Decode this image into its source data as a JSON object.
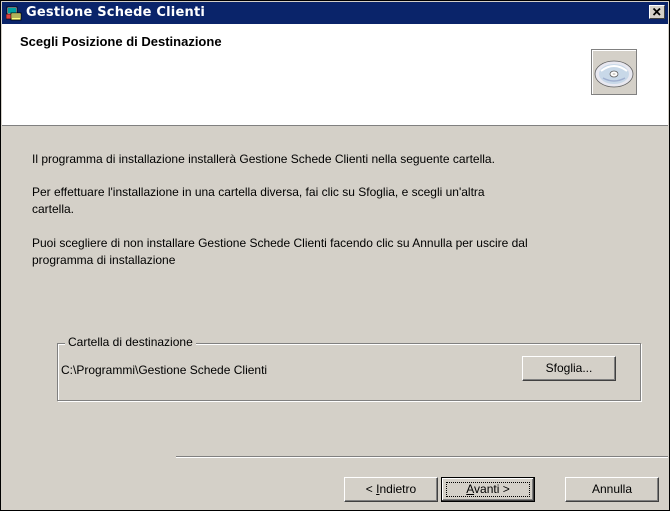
{
  "window": {
    "title": "Gestione Schede Clienti",
    "title_icon": "installer-icon",
    "close_icon": "close-icon"
  },
  "header": {
    "title": "Scegli Posizione di Destinazione",
    "icon": "cd-disc-icon"
  },
  "body": {
    "paragraph1": "Il programma di installazione installerà Gestione Schede Clienti nella seguente cartella.",
    "paragraph2_line1": "Per effettuare l'installazione in una cartella diversa, fai clic su Sfoglia, e scegli un'altra",
    "paragraph2_line2": "cartella.",
    "paragraph3_line1": "Puoi scegliere di non installare Gestione Schede Clienti facendo clic su Annulla per uscire dal",
    "paragraph3_line2": "programma di installazione"
  },
  "destination": {
    "group_label": "Cartella di destinazione",
    "path": "C:\\Programmi\\Gestione Schede Clienti",
    "browse_label": "Sfoglia..."
  },
  "buttons": {
    "back_prefix": "< ",
    "back_accel": "I",
    "back_rest": "ndietro",
    "next_accel": "A",
    "next_rest": "vanti >",
    "cancel_label": "Annulla"
  },
  "colors": {
    "titlebar": "#0a246a",
    "face": "#d4d0c8",
    "header_bg": "#ffffff"
  }
}
